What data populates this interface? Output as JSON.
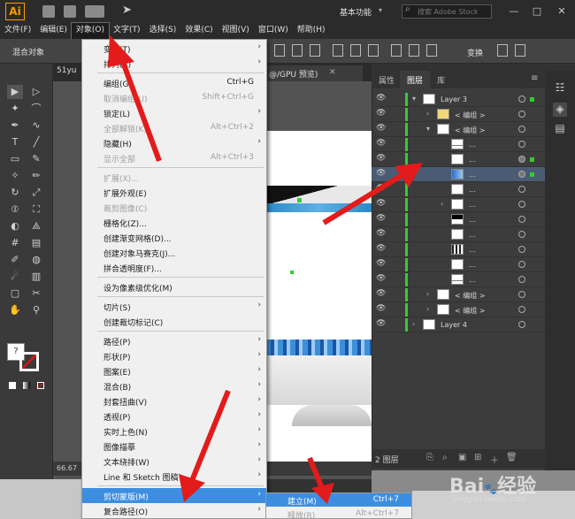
{
  "app": {
    "logo_text": "Ai",
    "workspace_label": "基本功能",
    "search_placeholder": "搜索 Adobe Stock",
    "window_buttons": [
      "—",
      "□",
      "✕"
    ]
  },
  "menubar": {
    "items": [
      "文件(F)",
      "编辑(E)",
      "对象(O)",
      "文字(T)",
      "选择(S)",
      "效果(C)",
      "视图(V)",
      "窗口(W)",
      "帮助(H)"
    ],
    "active_index": 2
  },
  "control_bar": {
    "label": "混合对象",
    "transform_label": "变换"
  },
  "document_tabs": [
    {
      "label": "51yu"
    },
    {
      "label": "@/GPU 预览)"
    }
  ],
  "status": {
    "zoom": "66.67"
  },
  "object_menu": {
    "items": [
      {
        "label": "变换(T)",
        "shortcut": "",
        "submenu": true,
        "disabled": false
      },
      {
        "label": "排列(A)",
        "shortcut": "",
        "submenu": true,
        "disabled": false
      },
      {
        "separator": true
      },
      {
        "label": "编组(G)",
        "shortcut": "Ctrl+G",
        "submenu": false,
        "disabled": false
      },
      {
        "label": "取消编组(U)",
        "shortcut": "Shift+Ctrl+G",
        "submenu": false,
        "disabled": true
      },
      {
        "label": "锁定(L)",
        "shortcut": "",
        "submenu": true,
        "disabled": false
      },
      {
        "label": "全部解锁(K)",
        "shortcut": "Alt+Ctrl+2",
        "submenu": false,
        "disabled": true
      },
      {
        "label": "隐藏(H)",
        "shortcut": "",
        "submenu": true,
        "disabled": false
      },
      {
        "label": "显示全部",
        "shortcut": "Alt+Ctrl+3",
        "submenu": false,
        "disabled": true
      },
      {
        "separator": true
      },
      {
        "label": "扩展(X)...",
        "shortcut": "",
        "submenu": false,
        "disabled": true
      },
      {
        "label": "扩展外观(E)",
        "shortcut": "",
        "submenu": false,
        "disabled": false
      },
      {
        "label": "裁剪图像(C)",
        "shortcut": "",
        "submenu": false,
        "disabled": true
      },
      {
        "label": "栅格化(Z)...",
        "shortcut": "",
        "submenu": false,
        "disabled": false
      },
      {
        "label": "创建渐变网格(D)...",
        "shortcut": "",
        "submenu": false,
        "disabled": false
      },
      {
        "label": "创建对象马赛克(J)...",
        "shortcut": "",
        "submenu": false,
        "disabled": false
      },
      {
        "label": "拼合透明度(F)...",
        "shortcut": "",
        "submenu": false,
        "disabled": false
      },
      {
        "separator": true
      },
      {
        "label": "设为像素级优化(M)",
        "shortcut": "",
        "submenu": false,
        "disabled": false
      },
      {
        "separator": true
      },
      {
        "label": "切片(S)",
        "shortcut": "",
        "submenu": true,
        "disabled": false
      },
      {
        "label": "创建裁切标记(C)",
        "shortcut": "",
        "submenu": false,
        "disabled": false
      },
      {
        "separator": true
      },
      {
        "label": "路径(P)",
        "shortcut": "",
        "submenu": true,
        "disabled": false
      },
      {
        "label": "形状(P)",
        "shortcut": "",
        "submenu": true,
        "disabled": false
      },
      {
        "label": "图案(E)",
        "shortcut": "",
        "submenu": true,
        "disabled": false
      },
      {
        "label": "混合(B)",
        "shortcut": "",
        "submenu": true,
        "disabled": false
      },
      {
        "label": "封套扭曲(V)",
        "shortcut": "",
        "submenu": true,
        "disabled": false
      },
      {
        "label": "透视(P)",
        "shortcut": "",
        "submenu": true,
        "disabled": false
      },
      {
        "label": "实时上色(N)",
        "shortcut": "",
        "submenu": true,
        "disabled": false
      },
      {
        "label": "图像描摹",
        "shortcut": "",
        "submenu": true,
        "disabled": false
      },
      {
        "label": "文本绕排(W)",
        "shortcut": "",
        "submenu": true,
        "disabled": false
      },
      {
        "label": "Line 和 Sketch 图稿",
        "shortcut": "",
        "submenu": true,
        "disabled": false
      },
      {
        "separator": true
      },
      {
        "label": "剪切蒙版(M)",
        "shortcut": "",
        "submenu": true,
        "disabled": false,
        "highlighted": true
      },
      {
        "label": "复合路径(O)",
        "shortcut": "",
        "submenu": true,
        "disabled": false
      }
    ]
  },
  "clipping_submenu": {
    "items": [
      {
        "label": "建立(M)",
        "shortcut": "Ctrl+7",
        "highlighted": true,
        "disabled": false
      },
      {
        "label": "释放(R)",
        "shortcut": "Alt+Ctrl+7",
        "highlighted": false,
        "disabled": true
      }
    ]
  },
  "layers_panel": {
    "tabs": [
      "属性",
      "图层",
      "库"
    ],
    "active_tab": 1,
    "rows": [
      {
        "name": "Layer 3",
        "indent": 0,
        "expanded": true,
        "thumb": "white",
        "selected": false,
        "targeted": false
      },
      {
        "name": "< 编组 >",
        "indent": 1,
        "expanded": false,
        "thumb": "folder",
        "selected": false,
        "targeted": false
      },
      {
        "name": "< 编组 >",
        "indent": 1,
        "expanded": true,
        "thumb": "white",
        "selected": false,
        "targeted": false
      },
      {
        "name": "...",
        "indent": 2,
        "expanded": null,
        "thumb": "line",
        "selected": false,
        "targeted": false
      },
      {
        "name": "...",
        "indent": 2,
        "expanded": null,
        "thumb": "white",
        "selected": false,
        "targeted": true
      },
      {
        "name": "...",
        "indent": 2,
        "expanded": null,
        "thumb": "blue",
        "selected": true,
        "targeted": true
      },
      {
        "name": "...",
        "indent": 2,
        "expanded": null,
        "thumb": "white",
        "selected": false,
        "targeted": false
      },
      {
        "name": "...",
        "indent": 2,
        "expanded": false,
        "thumb": "white",
        "selected": false,
        "targeted": false
      },
      {
        "name": "...",
        "indent": 2,
        "expanded": null,
        "thumb": "black",
        "selected": false,
        "targeted": false
      },
      {
        "name": "...",
        "indent": 2,
        "expanded": null,
        "thumb": "white",
        "selected": false,
        "targeted": false
      },
      {
        "name": "...",
        "indent": 2,
        "expanded": null,
        "thumb": "stripe",
        "selected": false,
        "targeted": false
      },
      {
        "name": "...",
        "indent": 2,
        "expanded": null,
        "thumb": "white",
        "selected": false,
        "targeted": false
      },
      {
        "name": "...",
        "indent": 2,
        "expanded": null,
        "thumb": "line",
        "selected": false,
        "targeted": false
      },
      {
        "name": "< 编组 >",
        "indent": 1,
        "expanded": false,
        "thumb": "white",
        "selected": false,
        "targeted": false
      },
      {
        "name": "< 编组 >",
        "indent": 1,
        "expanded": false,
        "thumb": "white",
        "selected": false,
        "targeted": false
      },
      {
        "name": "Layer 4",
        "indent": 0,
        "expanded": false,
        "thumb": "white",
        "selected": false,
        "targeted": false
      }
    ],
    "layer_count": "2 图层"
  },
  "watermark": {
    "text": "Bai 经验",
    "sub": "jingyan.baidu.com"
  },
  "colors": {
    "menu_highlight": "#3d8ee0",
    "layer_color": "#33cc33",
    "app_bg": "#323232",
    "logo_orange": "#ff9a00"
  },
  "tools": [
    "selection-icon",
    "direct-selection-icon",
    "magic-wand-icon",
    "lasso-icon",
    "pen-icon",
    "curvature-icon",
    "type-icon",
    "line-icon",
    "rectangle-icon",
    "paintbrush-icon",
    "shaper-icon",
    "pencil-icon",
    "rotate-icon",
    "scale-icon",
    "width-icon",
    "free-transform-icon",
    "shape-builder-icon",
    "perspective-icon",
    "mesh-icon",
    "gradient-icon",
    "eyedropper-icon",
    "blend-icon",
    "symbol-sprayer-icon",
    "graph-icon",
    "artboard-icon",
    "slice-icon",
    "hand-icon",
    "zoom-icon"
  ]
}
